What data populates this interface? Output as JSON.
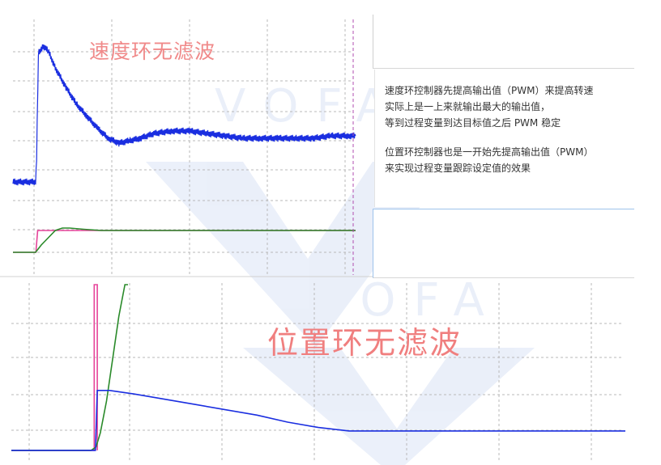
{
  "titles": {
    "top": "速度环无滤波",
    "bottom": "位置环无滤波"
  },
  "notes": {
    "p1_line1": "速度环控制器先提高输出值（PWM）来提高转速",
    "p1_line2": "实际上是一上来就输出最大的输出值，",
    "p1_line3": "等到过程变量到达目标值之后 PWM 稳定",
    "p2_line1": "位置环控制器也是一开始先提高输出值（PWM）",
    "p2_line2": "来实现过程变量跟踪设定值的效果"
  },
  "watermark": "VOFA",
  "colors": {
    "blue": "#1a2ee0",
    "green": "#2a8a2a",
    "pink": "#e6449a",
    "grid": "#b9b9b9",
    "cursor": "#b04db0"
  },
  "chart_data": [
    {
      "type": "line",
      "title": "速度环无滤波",
      "xlim": [
        0,
        100
      ],
      "ylim": [
        0,
        100
      ],
      "grid": true,
      "series": [
        {
          "color": "#1a2ee0",
          "noisy": true,
          "x": [
            0,
            6.4,
            6.7,
            7.2,
            8.5,
            10,
            12,
            15,
            18,
            21,
            24,
            27,
            30,
            33,
            36,
            40,
            45,
            50,
            55,
            60,
            65,
            70,
            75,
            80,
            85,
            90,
            95,
            97
          ],
          "y": [
            35,
            35,
            45,
            88,
            91,
            89,
            82,
            74,
            67,
            62,
            57,
            53,
            51,
            52,
            53,
            55,
            56,
            56,
            55,
            54,
            53,
            53,
            53,
            53,
            53,
            54,
            54,
            54
          ]
        },
        {
          "color": "#e6449a",
          "x": [
            0,
            6.5,
            7.0,
            25,
            97
          ],
          "y": [
            6,
            6,
            15,
            15,
            15
          ]
        },
        {
          "color": "#2a8a2a",
          "x": [
            0,
            6.4,
            8,
            10,
            12,
            14,
            16,
            20,
            25,
            30,
            40,
            50,
            60,
            70,
            80,
            90,
            97
          ],
          "y": [
            6,
            6,
            9,
            12,
            15,
            16,
            16,
            15.5,
            15,
            15,
            15,
            15,
            15,
            15,
            15,
            15,
            15
          ]
        }
      ]
    },
    {
      "type": "line",
      "title": "位置环无滤波",
      "xlim": [
        0,
        100
      ],
      "ylim": [
        0,
        100
      ],
      "grid": true,
      "series": [
        {
          "color": "#e6449a",
          "x": [
            0,
            13.5,
            13.5,
            14.0,
            14.0
          ],
          "y": [
            6,
            6,
            100,
            100,
            6
          ]
        },
        {
          "color": "#2a8a2a",
          "x": [
            0,
            13,
            13.8,
            14.5,
            15.5,
            16.5,
            17.5,
            18.5,
            19
          ],
          "y": [
            6,
            6,
            8,
            16,
            34,
            58,
            82,
            100,
            100
          ]
        },
        {
          "color": "#1a2ee0",
          "x": [
            0,
            13.7,
            14.0,
            16,
            20,
            25,
            30,
            35,
            40,
            45,
            50,
            55,
            60,
            70,
            80,
            90,
            100
          ],
          "y": [
            6,
            6,
            40,
            40,
            38,
            35,
            32,
            29,
            26,
            22,
            19,
            17,
            17,
            17,
            17,
            17,
            17
          ]
        }
      ]
    }
  ]
}
